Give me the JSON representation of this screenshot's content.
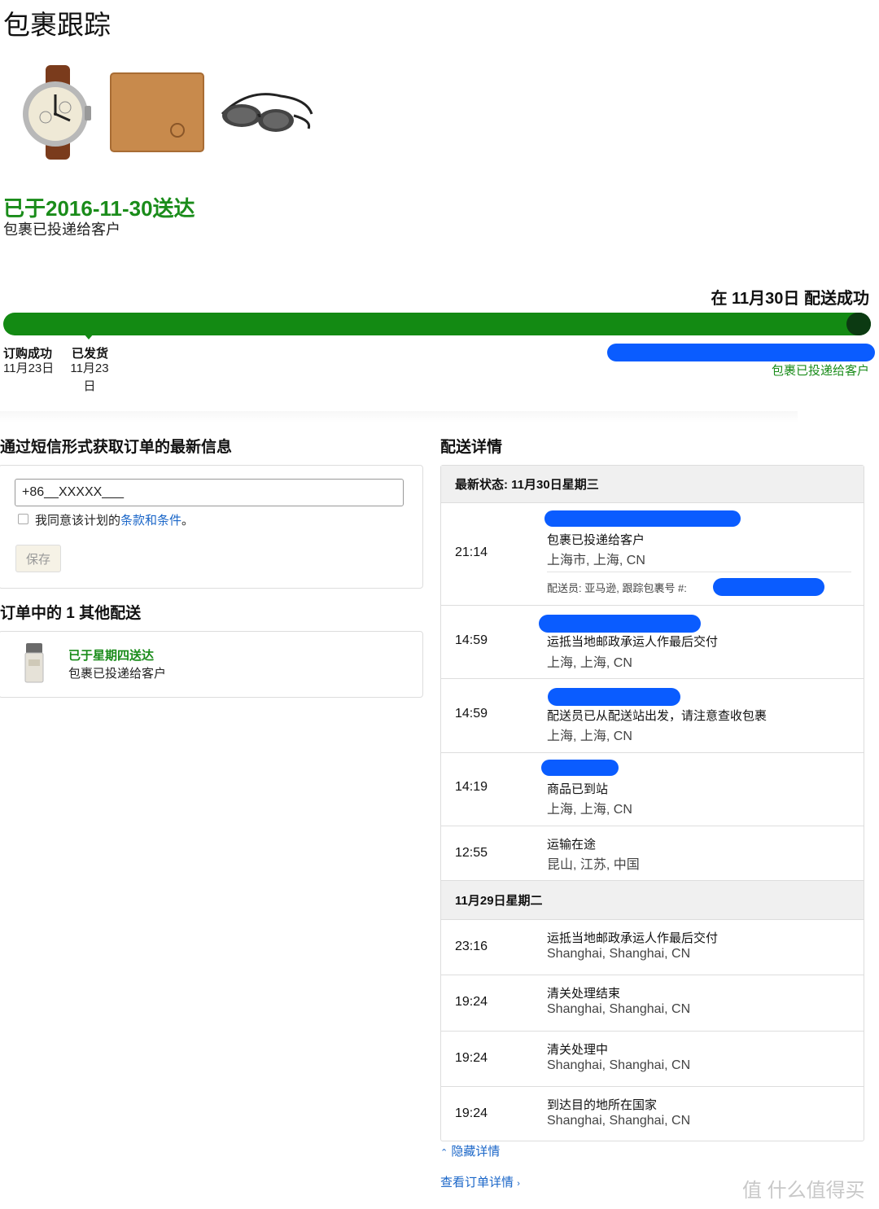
{
  "page_title": "包裹跟踪",
  "products": [
    {
      "name": "watch"
    },
    {
      "name": "wallet"
    },
    {
      "name": "goggles"
    }
  ],
  "status": {
    "title": "已于2016-11-30送达",
    "subtitle": "包裹已投递给客户"
  },
  "progress": {
    "label": "在 11月30日 配送成功",
    "fraction": 1.0,
    "milestones": [
      {
        "label": "订购成功",
        "date": "11月23日"
      },
      {
        "label": "已发货",
        "date": "11月23日"
      }
    ],
    "end_status": "包裹已投递给客户"
  },
  "sms": {
    "heading": "通过短信形式获取订单的最新信息",
    "phone_value": "+86__XXXXX___",
    "agree_prefix": "我同意该计划的",
    "agree_link": "条款和条件",
    "agree_suffix": "。",
    "save_label": "保存"
  },
  "other": {
    "heading": "订单中的 1 其他配送",
    "status": "已于星期四送达",
    "subtitle": "包裹已投递给客户"
  },
  "details": {
    "heading": "配送详情",
    "latest_prefix": "最新状态: ",
    "day1": "11月30日星期三",
    "day2": "11月29日星期二",
    "courier_label": "配送员:   亚马逊,  跟踪包裹号 #:",
    "events": [
      {
        "time": "21:14",
        "event": "包裹已投递给客户",
        "location": "上海市, 上海, CN"
      },
      {
        "time": "14:59",
        "event": "运抵当地邮政承运人作最后交付",
        "location": "上海, 上海, CN"
      },
      {
        "time": "14:59",
        "event": "配送员已从配送站出发，请注意查收包裹",
        "location": "上海, 上海, CN"
      },
      {
        "time": "14:19",
        "event": "商品已到站",
        "location": "上海, 上海, CN"
      },
      {
        "time": "12:55",
        "event": "运输在途",
        "location": "昆山, 江苏, 中国"
      },
      {
        "time": "23:16",
        "event": "运抵当地邮政承运人作最后交付",
        "location": "Shanghai, Shanghai, CN"
      },
      {
        "time": "19:24",
        "event": "清关处理结束",
        "location": "Shanghai, Shanghai, CN"
      },
      {
        "time": "19:24",
        "event": "清关处理中",
        "location": "Shanghai, Shanghai, CN"
      },
      {
        "time": "19:24",
        "event": "到达目的地所在国家",
        "location": "Shanghai, Shanghai, CN"
      }
    ],
    "hide_label": "隐藏详情",
    "order_link": "查看订单详情"
  },
  "colors": {
    "green": "#1a8c1a",
    "progress": "#138a13",
    "link": "#1a66c8",
    "redaction": "#0a5cff"
  },
  "watermark": "值 什么值得买"
}
